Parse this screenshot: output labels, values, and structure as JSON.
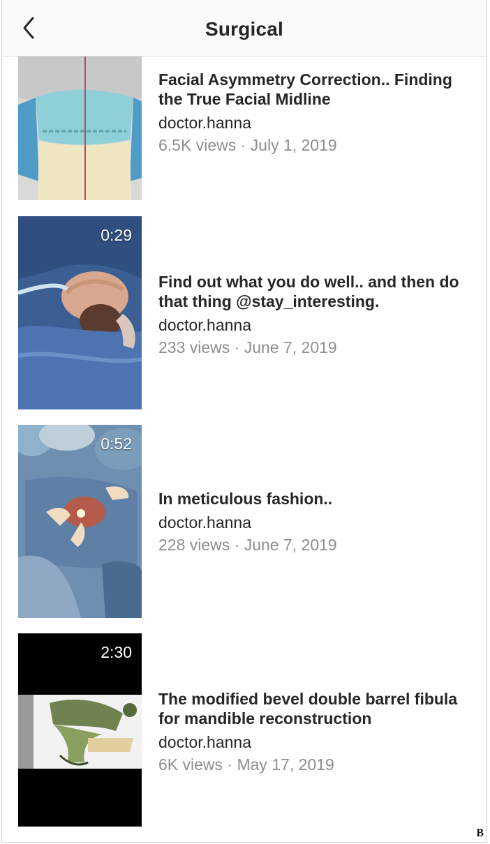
{
  "header": {
    "title": "Surgical",
    "back_icon": "chevron-left-icon"
  },
  "videos": [
    {
      "title": "Facial Asymmetry Correction.. Finding the True Facial Midline",
      "author": "doctor.hanna",
      "meta": "6.5K views · July 1, 2019",
      "duration": ""
    },
    {
      "title": "Find out what you do well.. and then do that thing @stay_interesting.",
      "author": "doctor.hanna",
      "meta": "233 views · June 7, 2019",
      "duration": "0:29"
    },
    {
      "title": "In meticulous fashion..",
      "author": "doctor.hanna",
      "meta": "228 views · June 7, 2019",
      "duration": "0:52"
    },
    {
      "title": "The modified bevel double barrel fibula for mandible reconstruction",
      "author": "doctor.hanna",
      "meta": "6K views · May 17, 2019",
      "duration": "2:30"
    }
  ],
  "figure_label": "B",
  "colors": {
    "text": "#262626",
    "meta": "#8e8e8e",
    "header_bg": "#fafafa",
    "divider": "#dbdbdb"
  }
}
